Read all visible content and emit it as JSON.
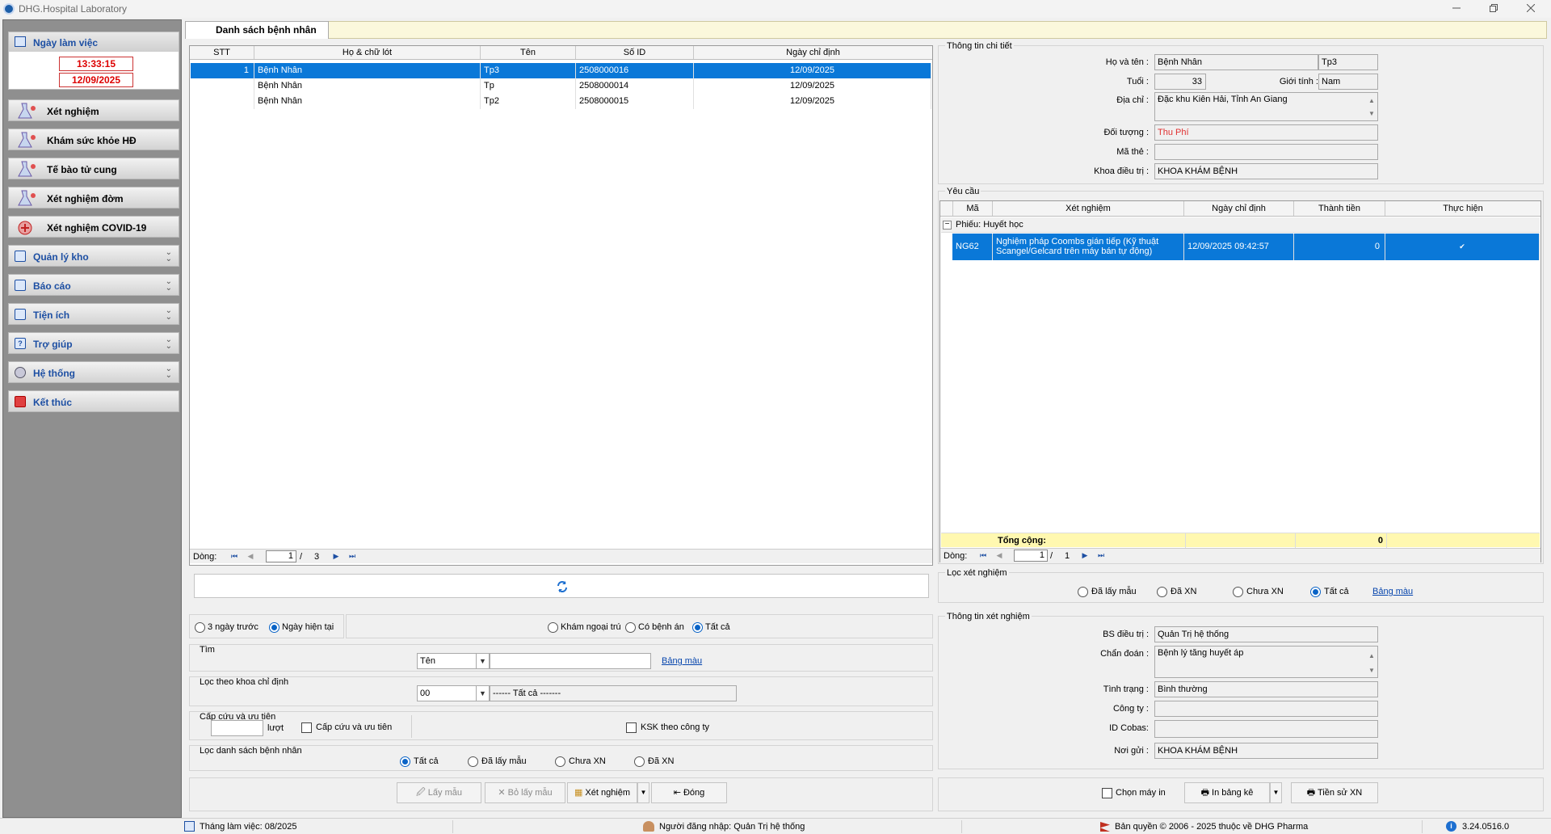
{
  "window": {
    "title": "DHG.Hospital Laboratory"
  },
  "sidebar": {
    "workday_label": "Ngày làm việc",
    "time": "13:33:15",
    "date": "12/09/2025",
    "items": [
      {
        "label": "Xét nghiệm"
      },
      {
        "label": "Khám sức khỏe HĐ"
      },
      {
        "label": "Tế bào tử cung"
      },
      {
        "label": "Xét nghiệm đờm"
      },
      {
        "label": "Xét nghiệm COVID-19"
      },
      {
        "label": "Quản lý kho"
      },
      {
        "label": "Báo cáo"
      },
      {
        "label": "Tiện ích"
      },
      {
        "label": "Trợ giúp"
      },
      {
        "label": "Hệ thống"
      },
      {
        "label": "Kết thúc"
      }
    ]
  },
  "tab": {
    "label": "Danh sách bệnh nhân"
  },
  "patients": {
    "columns": [
      "STT",
      "Họ & chữ lót",
      "Tên",
      "Số ID",
      "Ngày chỉ định"
    ],
    "rows": [
      {
        "stt": "1",
        "ho": "Bệnh Nhân",
        "ten": "Tp3",
        "id": "2508000016",
        "ngay": "12/09/2025"
      },
      {
        "stt": "",
        "ho": "Bệnh Nhân",
        "ten": "Tp",
        "id": "2508000014",
        "ngay": "12/09/2025"
      },
      {
        "stt": "",
        "ho": "Bệnh Nhân",
        "ten": "Tp2",
        "id": "2508000015",
        "ngay": "12/09/2025"
      }
    ],
    "pager": {
      "label": "Dòng:",
      "page": "1",
      "sep": "/",
      "total": "3"
    }
  },
  "filters": {
    "date_opts": [
      "3 ngày trước",
      "Ngày hiện tại"
    ],
    "type_opts": [
      "Khám ngoại trú",
      "Có bệnh án",
      "Tất cả"
    ],
    "search_group": "Tìm",
    "search_field": "Tên",
    "search_value": "",
    "color_table": "Bảng màu",
    "dept_group": "Lọc theo khoa chỉ định",
    "dept_code": "00",
    "dept_name": "------ Tất cả -------",
    "emergency_group": "Cấp cứu và ưu tiên",
    "count_value": "",
    "count_unit": "lượt",
    "emergency_check": "Cấp cứu và ưu tiên",
    "ksk_check": "KSK theo công ty",
    "list_group": "Lọc danh sách bệnh nhân",
    "list_opts": [
      "Tất cả",
      "Đã lấy mẫu",
      "Chưa XN",
      "Đã XN"
    ]
  },
  "buttons": {
    "lay_mau": "Lấy mẫu",
    "bo_lay_mau": "Bỏ lấy mẫu",
    "xet_nghiem": "Xét nghiệm",
    "dong": "Đóng",
    "chon_may_in": "Chọn máy in",
    "in_bang_ke": "In bảng kê",
    "tien_su_xn": "Tiền sử XN"
  },
  "detail": {
    "group": "Thông tin chi tiết",
    "name_label": "Họ và tên :",
    "name_value": "Bệnh Nhân",
    "name_value2": "Tp3",
    "age_label": "Tuổi :",
    "age_value": "33",
    "gender_label": "Giới tính :",
    "gender_value": "Nam",
    "address_label": "Địa chỉ :",
    "address_value": "Đặc khu Kiên Hải, Tỉnh An Giang",
    "subject_label": "Đối tượng :",
    "subject_value": "Thu Phí",
    "card_label": "Mã thẻ :",
    "card_value": "",
    "dept_label": "Khoa điều trị :",
    "dept_value": "KHOA KHÁM BỆNH"
  },
  "requests": {
    "group": "Yêu cầu",
    "columns": [
      "Mã",
      "Xét nghiệm",
      "Ngày chỉ định",
      "Thành tiền",
      "Thực hiện"
    ],
    "group_row": "Phiếu:  Huyết học",
    "rows": [
      {
        "ma": "NG62",
        "xn": "Nghiệm pháp Coombs gián tiếp (Kỹ thuật Scangel/Gelcard trên máy bán tự động)",
        "ngay": "12/09/2025 09:42:57",
        "tien": "0",
        "thuc_hien": "✔"
      }
    ],
    "total_label": "Tổng cộng:",
    "total_value": "0",
    "pager": {
      "label": "Dòng:",
      "page": "1",
      "sep": "/",
      "total": "1"
    }
  },
  "test_filter": {
    "group": "Lọc xét nghiệm",
    "opts": [
      "Đã lấy mẫu",
      "Đã XN",
      "Chưa XN",
      "Tất cả"
    ],
    "color_table": "Bảng màu"
  },
  "test_info": {
    "group": "Thông tin xét nghiệm",
    "doctor_label": "BS điều trị :",
    "doctor_value": "Quản Trị hệ thống",
    "diag_label": "Chẩn đoán :",
    "diag_value": "Bệnh lý tăng huyết áp",
    "status_label": "Tình trạng :",
    "status_value": "Bình thường",
    "company_label": "Công ty :",
    "company_value": "",
    "cobas_label": "ID Cobas:",
    "cobas_value": "",
    "sender_label": "Nơi gửi :",
    "sender_value": "KHOA KHÁM BỆNH"
  },
  "statusbar": {
    "month": "Tháng làm việc: 08/2025",
    "user": "Người đăng nhập: Quản Trị hệ thống",
    "copyright": "Bản quyền © 2006 - 2025 thuộc về DHG Pharma",
    "version": "3.24.0516.0"
  },
  "colors": {
    "selection": "#0a78d8",
    "accent": "#1d4fa3",
    "total_row": "#fff8b0",
    "subject_red": "#e03030"
  }
}
